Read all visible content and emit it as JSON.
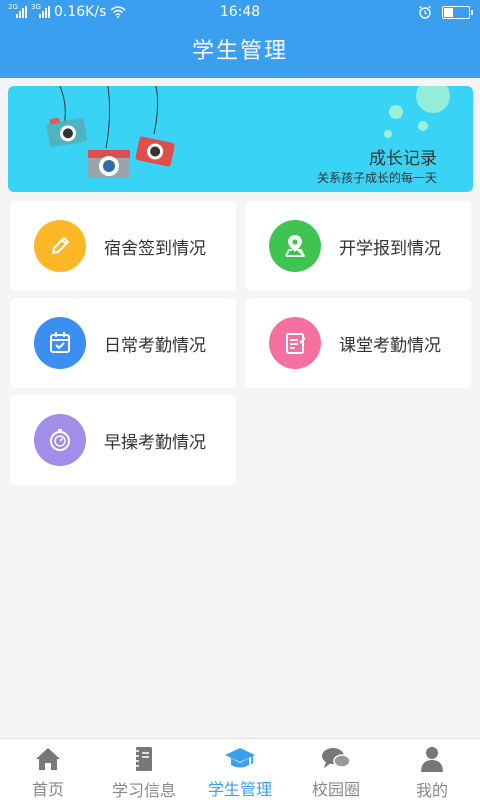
{
  "status": {
    "network": "0.16K/s",
    "time": "16:48",
    "sim1_label": "2G",
    "sim2_label": "3G"
  },
  "header": {
    "title": "学生管理"
  },
  "banner": {
    "title": "成长记录",
    "subtitle": "关系孩子成长的每一天"
  },
  "menu": {
    "items": [
      {
        "label": "宿舍签到情况",
        "icon": "pencil-icon",
        "color": "#fbb726"
      },
      {
        "label": "开学报到情况",
        "icon": "map-pin-icon",
        "color": "#3fc451"
      },
      {
        "label": "日常考勤情况",
        "icon": "calendar-check-icon",
        "color": "#3b8ff0"
      },
      {
        "label": "课堂考勤情况",
        "icon": "notepad-icon",
        "color": "#f5709f"
      },
      {
        "label": "早操考勤情况",
        "icon": "stopwatch-icon",
        "color": "#a28de8"
      }
    ]
  },
  "nav": {
    "items": [
      {
        "label": "首页",
        "icon": "home-icon",
        "active": false
      },
      {
        "label": "学习信息",
        "icon": "notebook-icon",
        "active": false
      },
      {
        "label": "学生管理",
        "icon": "graduation-cap-icon",
        "active": true
      },
      {
        "label": "校园圈",
        "icon": "chat-bubbles-icon",
        "active": false
      },
      {
        "label": "我的",
        "icon": "user-icon",
        "active": false
      }
    ]
  },
  "colors": {
    "primary": "#3b9ff0",
    "banner": "#39d3f5",
    "inactive": "#888888"
  }
}
